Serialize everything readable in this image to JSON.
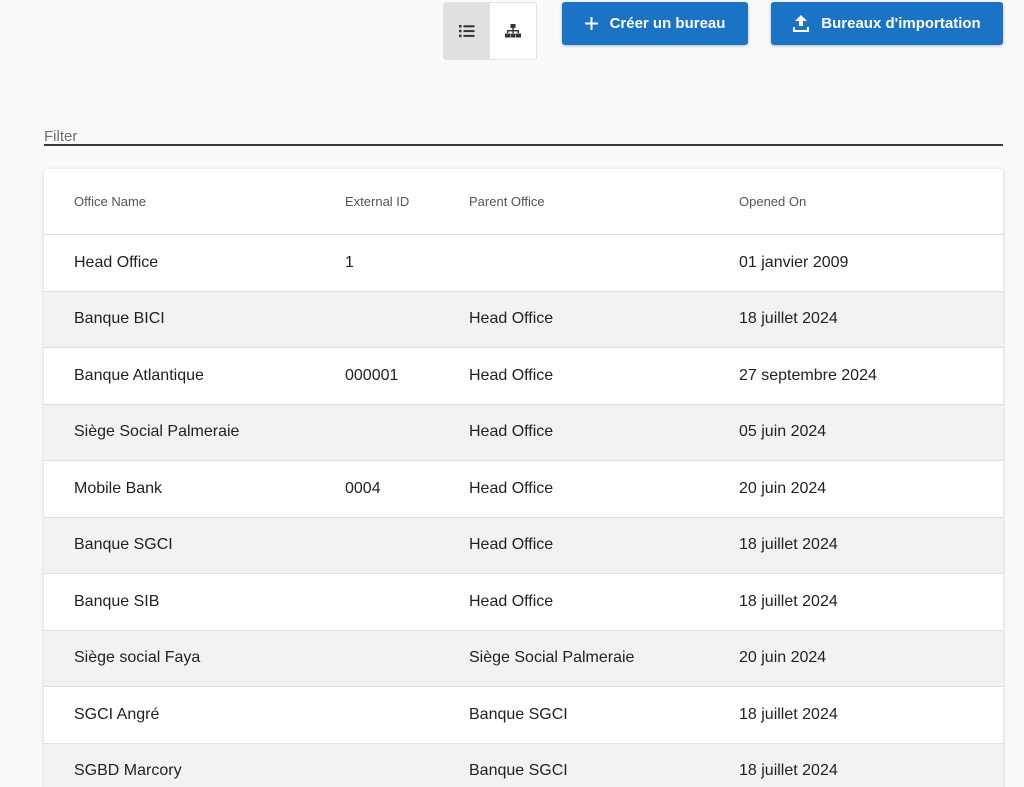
{
  "toolbar": {
    "view_toggle": [
      {
        "name": "list-view",
        "icon": "list-icon",
        "active": true
      },
      {
        "name": "tree-view",
        "icon": "sitemap-icon",
        "active": false
      }
    ],
    "create_label": "Créer un bureau",
    "import_label": "Bureaux d'importation",
    "accent_color": "#1a73c4"
  },
  "filter": {
    "placeholder": "Filter",
    "value": ""
  },
  "table": {
    "headers": [
      "Office Name",
      "External ID",
      "Parent Office",
      "Opened On"
    ],
    "rows": [
      [
        "Head Office",
        "1",
        "",
        "01 janvier 2009"
      ],
      [
        "Banque BICI",
        "",
        "Head Office",
        "18 juillet 2024"
      ],
      [
        "Banque Atlantique",
        "000001",
        "Head Office",
        "27 septembre 2024"
      ],
      [
        "Siège Social Palmeraie",
        "",
        "Head Office",
        "05 juin 2024"
      ],
      [
        "Mobile Bank",
        "0004",
        "Head Office",
        "20 juin 2024"
      ],
      [
        "Banque SGCI",
        "",
        "Head Office",
        "18 juillet 2024"
      ],
      [
        "Banque SIB",
        "",
        "Head Office",
        "18 juillet 2024"
      ],
      [
        "Siège social Faya",
        "",
        "Siège Social Palmeraie",
        "20 juin 2024"
      ],
      [
        "SGCI Angré",
        "",
        "Banque SGCI",
        "18 juillet 2024"
      ],
      [
        "SGBD Marcory",
        "",
        "Banque SGCI",
        "18 juillet 2024"
      ]
    ]
  }
}
